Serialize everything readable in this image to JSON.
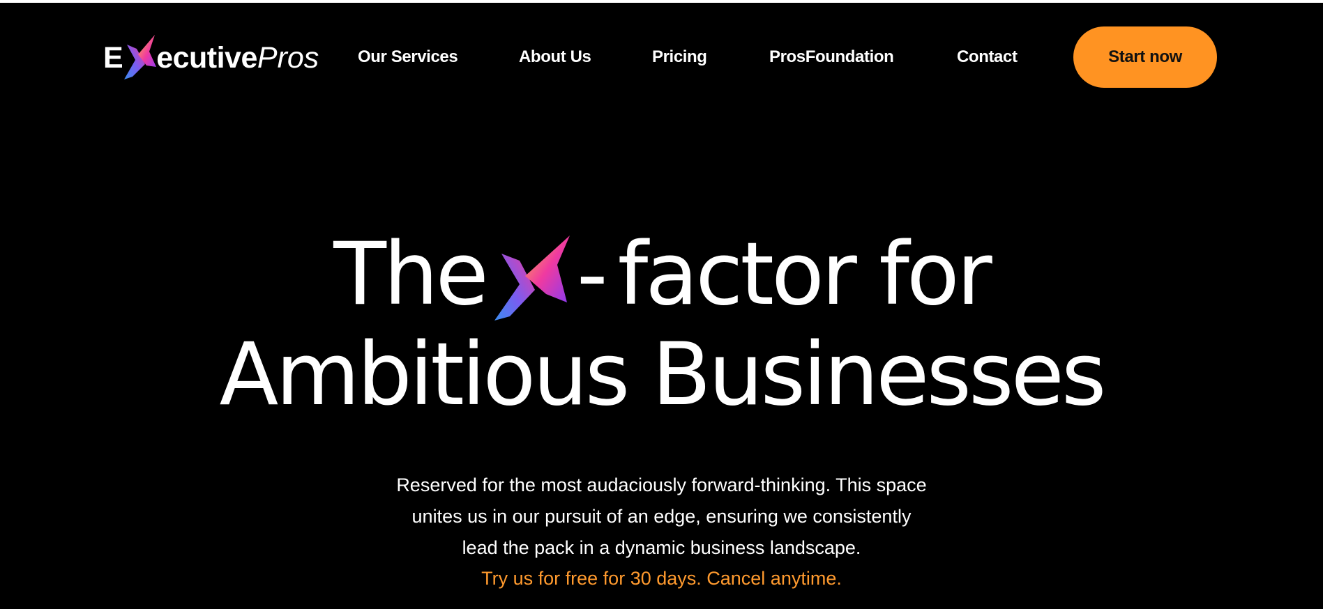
{
  "brand": {
    "logo_prefix": "E",
    "logo_middle": "ecutive",
    "logo_suffix": "Pros",
    "logo_icon": "x-logo-icon"
  },
  "nav": {
    "items": [
      {
        "label": "Our Services"
      },
      {
        "label": "About Us"
      },
      {
        "label": "Pricing"
      },
      {
        "label": "ProsFoundation"
      },
      {
        "label": "Contact"
      }
    ],
    "cta_label": "Start now"
  },
  "hero": {
    "title_word_1": "The",
    "title_dash": "-",
    "title_rest_line1": "factor for",
    "title_line2": "Ambitious Businesses",
    "subtitle_lines": [
      "Reserved for the most audaciously forward-thinking. This space",
      "unites us in our pursuit of an edge, ensuring we consistently",
      "lead the pack in a dynamic business landscape."
    ],
    "trial_text": "Try us for free for 30 days. Cancel anytime."
  },
  "colors": {
    "background": "#000000",
    "text": "#ffffff",
    "accent": "#ff9322",
    "trial_text": "#ff9a2e",
    "x_gradient": [
      "#3b8df0",
      "#7b5cf0",
      "#f03aa0",
      "#ff9322"
    ]
  }
}
